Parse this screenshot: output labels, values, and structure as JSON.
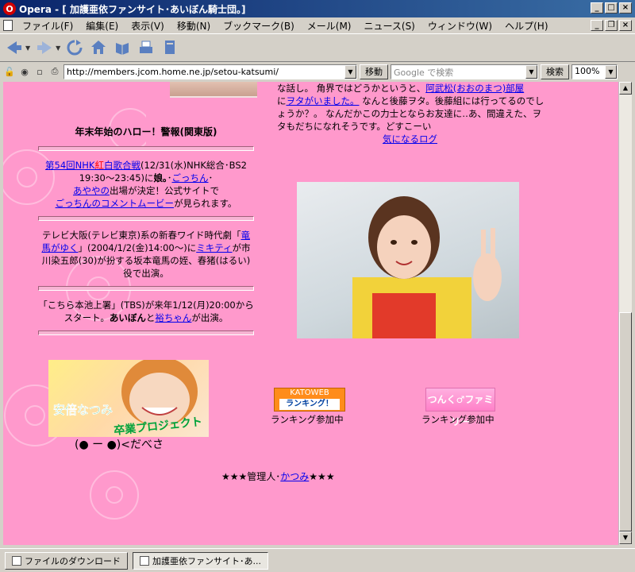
{
  "window": {
    "title": "Opera - [ 加護亜依ファンサイト･あいぼん騎士団。]",
    "app_icon_letter": "O"
  },
  "menu": [
    "ファイル(F)",
    "編集(E)",
    "表示(V)",
    "移動(N)",
    "ブックマーク(B)",
    "メール(M)",
    "ニュース(S)",
    "ウィンドウ(W)",
    "ヘルプ(H)"
  ],
  "address": {
    "url": "http://members.jcom.home.ne.jp/setou-katsumi/",
    "go_label": "移動",
    "search_placeholder": "Google で検索",
    "search_label": "検索",
    "zoom": "100%"
  },
  "page": {
    "notice_title": "年末年始のハロー！警報(関東版)",
    "news1": {
      "link1": "第54回NHK",
      "kohaku_red": "紅",
      "kohaku_white": "白",
      "link1b": "歌合戦",
      "text1": "(12/31(水)NHK総合･BS2 19:30〜23:45)に",
      "bold1": "娘｡",
      "sep": "･",
      "link2": "ごっちん",
      "sep2": "･",
      "link3": "あややの",
      "text2": "出場が決定！公式サイトで",
      "link4": "ごっちんのコメントムービー",
      "text3": "が見られます。"
    },
    "news2": {
      "text1": "テレビ大阪(テレビ東京)系の新春ワイド時代劇「",
      "link1": "竜馬がゆく",
      "text2": "」(2004/1/2(金)14:00〜)に",
      "link2": "ミキティ",
      "text3": "が市川染五郎(30)が扮する坂本竜馬の姪、春猪(はるい)役で出演。"
    },
    "news3": {
      "text1": "「こちら本池上署」(TBS)が来年1/12(月)20:00からスタート。",
      "bold1": "あいぼん",
      "text2": "と",
      "link1": "裕ちゃん",
      "text3": "が出演。"
    },
    "right_text": {
      "t1": "な話し。 角界ではどうかというと、",
      "link1": "阿武松(おおのまつ)部屋",
      "t2": "に",
      "link2": "ヲタがいました。",
      "t3": " なんと後藤ヲタ。後藤組には行ってるのでしょうか？。 なんだかこの力士とならお友達に‥あ、間違えた、ヲタもだちになれそうです。どすこーい"
    },
    "log_link": "気になるログ",
    "natsumi_banner": {
      "line1": "安倍なつみ",
      "line2": "卒業プロジェクト"
    },
    "face_text": "(●  ー ●)<だべさ",
    "ranking1": {
      "top": "KATOWEB",
      "bottom": "ランキング！",
      "caption": "ランキング参加中"
    },
    "ranking2": {
      "logo": "つんく♂ファミリー",
      "caption": "ランキング参加中"
    },
    "footer": {
      "prefix": "★★★管理人･",
      "link": "かつみ",
      "suffix": "★★★"
    }
  },
  "taskbar": {
    "download": "ファイルのダウンロード",
    "active_tab": "加護亜依ファンサイト･あ..."
  }
}
